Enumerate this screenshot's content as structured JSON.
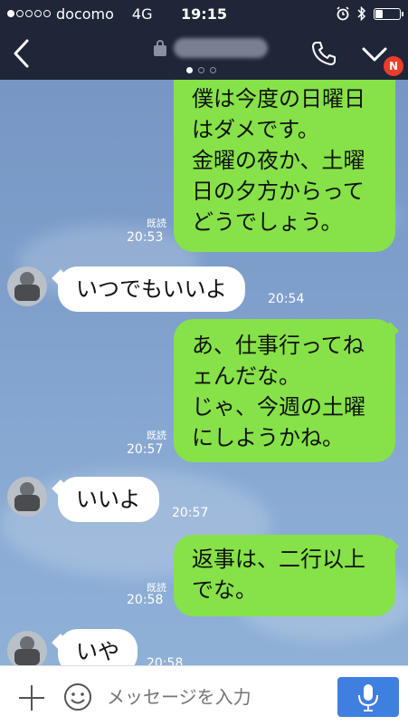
{
  "status": {
    "carrier": "docomo",
    "network": "4G",
    "time": "19:15"
  },
  "header": {
    "notification_badge": "N",
    "page_count": 3,
    "active_page": 1
  },
  "messages": [
    {
      "side": "right",
      "lines": [
        "僕は今度の日曜日",
        "はダメです。",
        "金曜の夜か、土曜",
        "日の夕方からって",
        "どうでしょう。"
      ],
      "read": "既読",
      "time": "20:53"
    },
    {
      "side": "left",
      "text": "いつでもいいよ",
      "time": "20:54"
    },
    {
      "side": "right",
      "lines": [
        "あ、仕事行ってね",
        "ェんだな。",
        "じゃ、今週の土曜",
        "にしようかね。"
      ],
      "read": "既読",
      "time": "20:57"
    },
    {
      "side": "left",
      "text": "いいよ",
      "time": "20:57"
    },
    {
      "side": "right",
      "lines": [
        "返事は、二行以上",
        "でな。"
      ],
      "read": "既読",
      "time": "20:58"
    },
    {
      "side": "left",
      "text": "いや",
      "time": "20:58"
    }
  ],
  "input": {
    "placeholder": "メッセージを入力"
  },
  "colors": {
    "header_bg": "#1f2638",
    "sent_bubble": "#86e248",
    "received_bubble": "#ffffff",
    "mic_button": "#3f7fe0",
    "badge": "#ee3c2b"
  }
}
